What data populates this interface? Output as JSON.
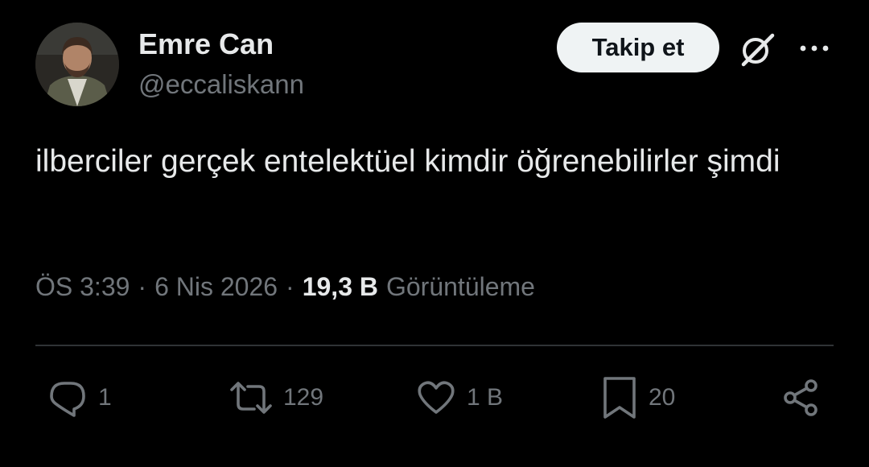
{
  "author": {
    "display_name": "Emre Can",
    "handle": "@eccaliskann"
  },
  "header": {
    "follow_label": "Takip et",
    "icons": [
      "grok-icon",
      "more-options-icon"
    ]
  },
  "tweet": {
    "text": "ilberciler gerçek entelektüel kimdir öğrenebilirler şimdi"
  },
  "meta": {
    "time": "ÖS 3:39",
    "separator": "·",
    "date": "6 Nis 2026",
    "views_count": "19,3 B",
    "views_label": "Görüntüleme"
  },
  "actions": {
    "reply": {
      "icon": "reply-icon",
      "count": "1"
    },
    "repost": {
      "icon": "repost-icon",
      "count": "129"
    },
    "like": {
      "icon": "heart-icon",
      "count": "1 B"
    },
    "bookmark": {
      "icon": "bookmark-icon",
      "count": "20"
    },
    "share": {
      "icon": "share-icon"
    }
  },
  "colors": {
    "background": "#000000",
    "primary_text": "#e7e9ea",
    "secondary_text": "#71767b",
    "divider": "#2f3336",
    "follow_button_bg": "#eff3f4"
  }
}
